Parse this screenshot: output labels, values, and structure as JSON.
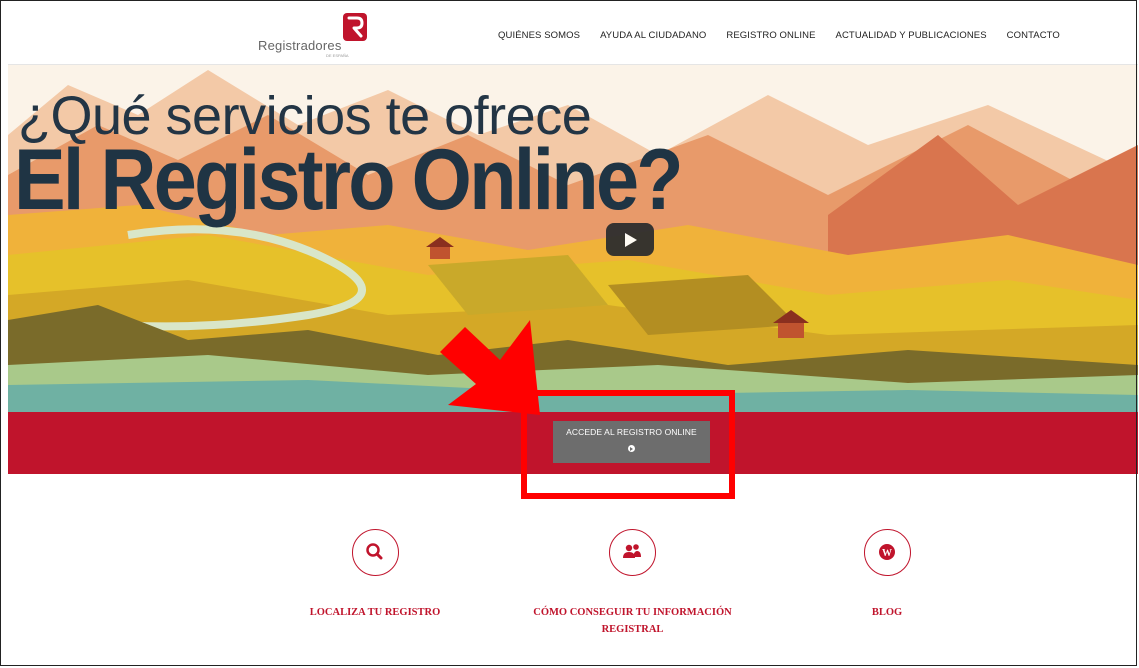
{
  "header": {
    "logo_text": "Registradores",
    "logo_sub": "DE ESPAÑA",
    "nav": [
      "QUIÉNES SOMOS",
      "AYUDA AL CIUDADANO",
      "REGISTRO ONLINE",
      "ACTUALIDAD Y PUBLICACIONES",
      "CONTACTO"
    ]
  },
  "hero": {
    "line1": "¿Qué servicios te ofrece",
    "line2": "El Registro Online?",
    "play_icon": "play-icon"
  },
  "cta": {
    "label": "ACCEDE AL REGISTRO ONLINE",
    "icon": "chevron-right-circle-icon"
  },
  "services": [
    {
      "label": "LOCALIZA TU REGISTRO",
      "icon": "search-icon"
    },
    {
      "label_line1": "CÓMO CONSEGUIR TU INFORMACIÓN",
      "label_line2": "REGISTRAL",
      "icon": "users-icon"
    },
    {
      "label": "BLOG",
      "icon": "wordpress-icon"
    }
  ],
  "colors": {
    "brand_red": "#c0142c",
    "annotation_red": "#ff0000",
    "cta_gray": "#6d6d6d"
  }
}
